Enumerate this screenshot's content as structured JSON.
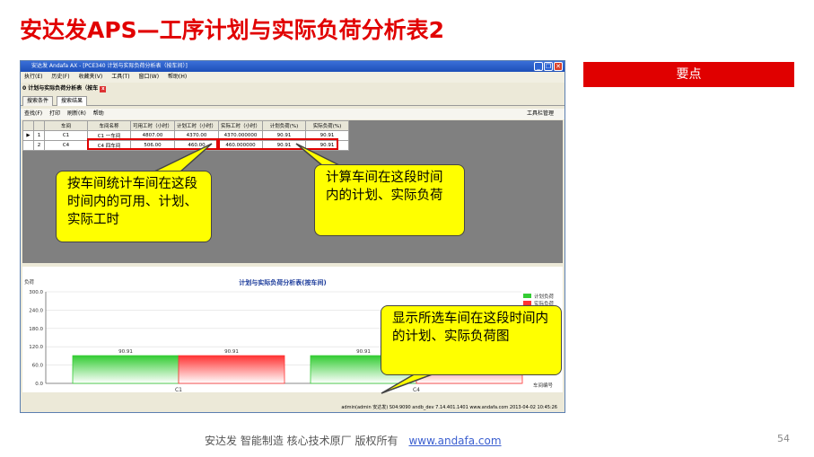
{
  "slide": {
    "title": "安达发APS—工序计划与实际负荷分析表2",
    "keypoints_label": "要点",
    "footer_company": "安达发   智能制造 核心技术原厂    版权所有",
    "footer_url": "www.andafa.com",
    "page_number": "54"
  },
  "window": {
    "title": "安达发 Andafa AX - [PCE340 计划与实际负荷分析表（按车间）]",
    "controls": [
      "_",
      "❐",
      "✕"
    ]
  },
  "menu": [
    "执行(E)",
    "历史(F)",
    "收藏夹(V)",
    "工具(T)",
    "窗口(W)",
    "帮助(H)"
  ],
  "doc_tab": "0 计划与实际负荷分析表（按车",
  "sub_tabs": [
    "搜索条件",
    "搜索结果"
  ],
  "toolbar": {
    "items": [
      "查找(F)",
      "打印",
      "刷新(R)",
      "帮助"
    ],
    "right": "工具栏管理"
  },
  "table": {
    "headers": [
      "车间",
      "车间名称",
      "可用工时（小时）",
      "计划工时（小时）",
      "实际工时（小时）",
      "计划负荷(%)",
      "实际负荷(%)"
    ],
    "rows": [
      {
        "marker": "▶",
        "index": "1",
        "cells": [
          "C1",
          "C1 一车间",
          "4807.00",
          "4370.00",
          "4370.000000",
          "90.91",
          "90.91"
        ]
      },
      {
        "marker": "",
        "index": "2",
        "cells": [
          "C4",
          "C4 四车间",
          "506.00",
          "460.00",
          "460.000000",
          "90.91",
          "90.91"
        ]
      }
    ]
  },
  "chart_data": {
    "type": "bar",
    "title": "计划与实际负荷分析表(按车间)",
    "ylabel": "负荷",
    "xlabel": "车间编号",
    "categories": [
      "C1",
      "C4"
    ],
    "series": [
      {
        "name": "计划负荷",
        "values": [
          90.91,
          90.91
        ],
        "color": "#33cc33"
      },
      {
        "name": "实际负荷",
        "values": [
          90.91,
          90.91
        ],
        "color": "#ff3333"
      }
    ],
    "ylim": [
      0,
      300
    ],
    "yticks": [
      "300.0",
      "240.0",
      "180.0",
      "120.0",
      "60.0",
      "0.0"
    ],
    "data_labels": [
      "90.91",
      "90.91",
      "90.91"
    ],
    "legend": "top-right"
  },
  "statusbar": "admin(admin 安达发)  S04:9090  andb_dev  7.14.401.1401  www.andafa.com  2013-04-02 10:45:26",
  "callouts": {
    "left": "按车间统计车间在这段时间内的可用、计划、实际工时",
    "right": "计算车间在这段时间内的计划、实际负荷",
    "bottom": "显示所选车间在这段时间内的计划、实际负荷图"
  },
  "colors": {
    "title_red": "#e10000",
    "callout_yellow": "#ffff00",
    "highlight_red": "#e00000"
  }
}
